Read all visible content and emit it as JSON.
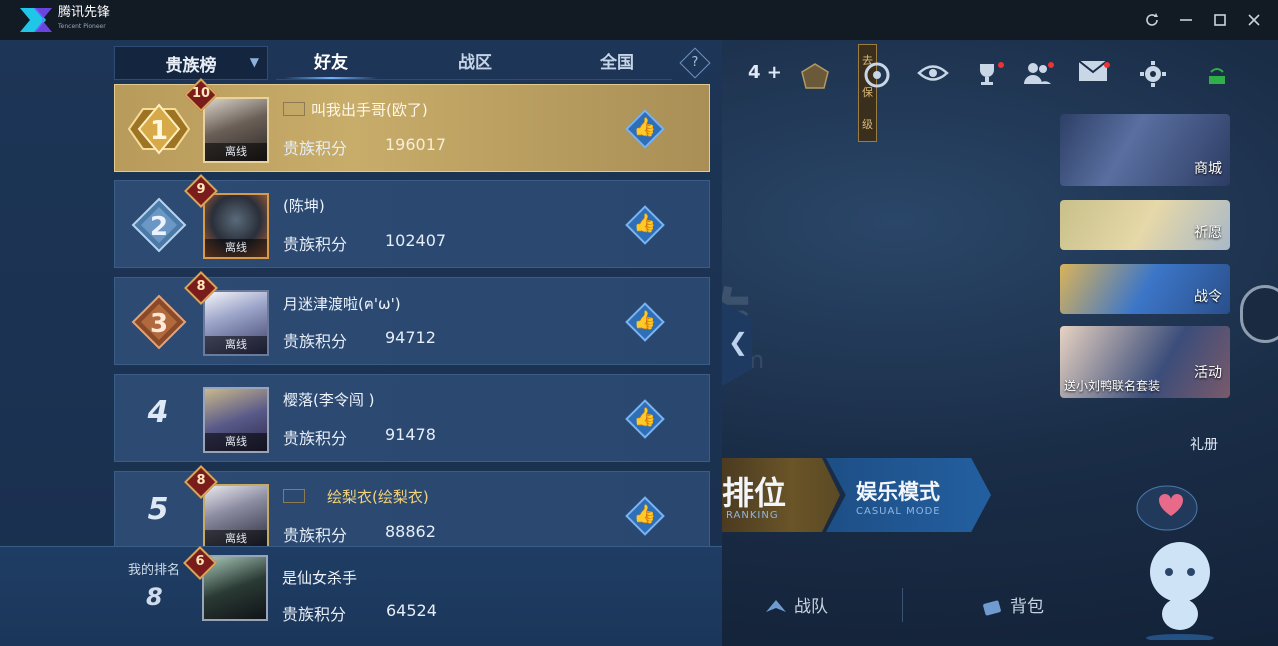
{
  "titlebar": {
    "app_name": "腾讯先锋",
    "app_sub": "Tencent Pioneer"
  },
  "lobby": {
    "level_plus": "4",
    "rank_tag": "去保级",
    "side_cards": [
      {
        "label": "商城"
      },
      {
        "label": "祈愿"
      },
      {
        "label": "战令"
      },
      {
        "label": "活动",
        "sub": "送小刘鸭联名套装"
      }
    ],
    "gift_label": "礼册",
    "modes": {
      "rank_title": "排位",
      "rank_sub": "RANKING",
      "casual_title": "娱乐模式",
      "casual_sub": "CASUAL MODE"
    },
    "bottom": {
      "team": "战队",
      "bag": "背包"
    }
  },
  "leaderboard": {
    "dropdown": "贵族榜",
    "tabs": [
      "好友",
      "战区",
      "全国"
    ],
    "active_tab": 0,
    "help": "?",
    "score_label": "贵族积分",
    "offline_label": "离线",
    "rows": [
      {
        "rank": "1",
        "level": "10",
        "name": "叫我出手哥(欧了)",
        "score": "196017",
        "gold": true
      },
      {
        "rank": "2",
        "level": "9",
        "name": "(陈坤)",
        "score": "102407"
      },
      {
        "rank": "3",
        "level": "8",
        "name": "月迷津渡啦(ฅ'ω')",
        "score": "94712"
      },
      {
        "rank": "4",
        "level": "",
        "name": "樱落(李令闯 )",
        "score": "91478"
      },
      {
        "rank": "5",
        "level": "8",
        "name": "绘梨衣(绘梨衣)",
        "score": "88862"
      }
    ],
    "mine": {
      "label": "我的排名",
      "rank": "8",
      "level": "6",
      "name": "是仙女杀手",
      "score": "64524"
    }
  },
  "watermark": {
    "main": "淘手游",
    "sub": "Taoshouyou.Com"
  }
}
